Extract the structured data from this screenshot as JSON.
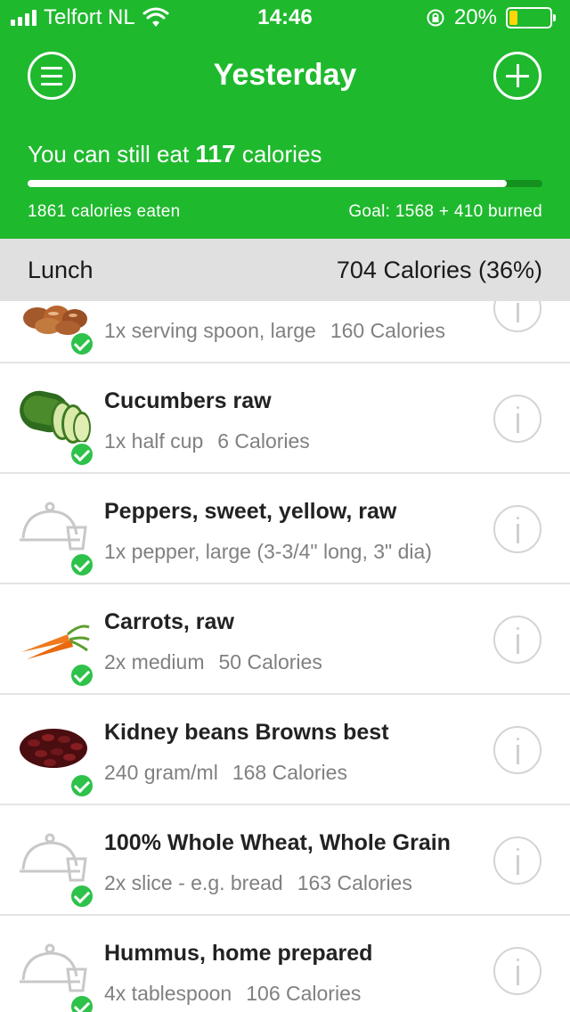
{
  "status_bar": {
    "carrier": "Telfort NL",
    "time": "14:46",
    "battery_percent": "20%",
    "battery_level": 0.2,
    "battery_color": "#ffd60a"
  },
  "header": {
    "title": "Yesterday",
    "remaining_prefix": "You can still eat",
    "remaining_value": "117",
    "remaining_suffix": "calories",
    "progress_fraction": 0.93,
    "eaten_text": "1861 calories eaten",
    "goal_text": "Goal: 1568 + 410 burned",
    "brand_color": "#1fb92e"
  },
  "section": {
    "name": "Lunch",
    "calories": "704 Calories (36%)"
  },
  "items": [
    {
      "title": "",
      "amount": "1x serving spoon, large",
      "calories": "160 Calories",
      "icon": "bread-rolls-photo"
    },
    {
      "title": "Cucumbers raw",
      "amount": "1x half cup",
      "calories": "6 Calories",
      "icon": "cucumber-photo"
    },
    {
      "title": "Peppers, sweet, yellow, raw",
      "amount": "1x pepper, large (3-3/4\" long, 3\" dia)",
      "calories": "",
      "icon": "meal-placeholder-icon"
    },
    {
      "title": "Carrots, raw",
      "amount": "2x medium",
      "calories": "50 Calories",
      "icon": "carrot-photo"
    },
    {
      "title": "Kidney beans Browns best",
      "amount": "240 gram/ml",
      "calories": "168 Calories",
      "icon": "kidney-beans-photo"
    },
    {
      "title": "100% Whole Wheat, Whole Grain",
      "amount": "2x slice - e.g. bread",
      "calories": "163 Calories",
      "icon": "meal-placeholder-icon"
    },
    {
      "title": "Hummus, home prepared",
      "amount": "4x tablespoon",
      "calories": "106 Calories",
      "icon": "meal-placeholder-icon"
    }
  ]
}
